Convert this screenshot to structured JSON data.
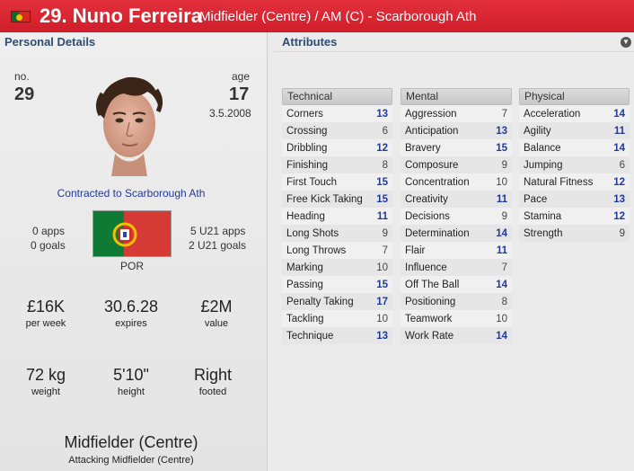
{
  "header": {
    "name": "29. Nuno Ferreira",
    "role": "Midfielder (Centre) / AM (C) - Scarborough Ath"
  },
  "personal": {
    "title": "Personal Details",
    "no_label": "no.",
    "no_value": "29",
    "age_label": "age",
    "age_value": "17",
    "dob": "3.5.2008",
    "contract": "Contracted to Scarborough Ath",
    "apps": "0 apps",
    "goals": "0 goals",
    "u21_apps": "5 U21 apps",
    "u21_goals": "2 U21 goals",
    "nation": "POR",
    "wage_value": "£16K",
    "wage_label": "per week",
    "expires_value": "30.6.28",
    "expires_label": "expires",
    "value_value": "£2M",
    "value_label": "value",
    "weight_value": "72 kg",
    "weight_label": "weight",
    "height_value": "5'10\"",
    "height_label": "height",
    "foot_value": "Right",
    "foot_label": "footed",
    "position_main": "Midfielder (Centre)",
    "position_sub": "Attacking Midfielder (Centre)"
  },
  "attributes": {
    "title": "Attributes",
    "technical": {
      "label": "Technical",
      "rows": [
        {
          "name": "Corners",
          "value": "13"
        },
        {
          "name": "Crossing",
          "value": "6"
        },
        {
          "name": "Dribbling",
          "value": "12"
        },
        {
          "name": "Finishing",
          "value": "8"
        },
        {
          "name": "First Touch",
          "value": "15"
        },
        {
          "name": "Free Kick Taking",
          "value": "15"
        },
        {
          "name": "Heading",
          "value": "11"
        },
        {
          "name": "Long Shots",
          "value": "9"
        },
        {
          "name": "Long Throws",
          "value": "7"
        },
        {
          "name": "Marking",
          "value": "10"
        },
        {
          "name": "Passing",
          "value": "15"
        },
        {
          "name": "Penalty Taking",
          "value": "17"
        },
        {
          "name": "Tackling",
          "value": "10"
        },
        {
          "name": "Technique",
          "value": "13"
        }
      ]
    },
    "mental": {
      "label": "Mental",
      "rows": [
        {
          "name": "Aggression",
          "value": "7"
        },
        {
          "name": "Anticipation",
          "value": "13"
        },
        {
          "name": "Bravery",
          "value": "15"
        },
        {
          "name": "Composure",
          "value": "9"
        },
        {
          "name": "Concentration",
          "value": "10"
        },
        {
          "name": "Creativity",
          "value": "11"
        },
        {
          "name": "Decisions",
          "value": "9"
        },
        {
          "name": "Determination",
          "value": "14"
        },
        {
          "name": "Flair",
          "value": "11"
        },
        {
          "name": "Influence",
          "value": "7"
        },
        {
          "name": "Off The Ball",
          "value": "14"
        },
        {
          "name": "Positioning",
          "value": "8"
        },
        {
          "name": "Teamwork",
          "value": "10"
        },
        {
          "name": "Work Rate",
          "value": "14"
        }
      ]
    },
    "physical": {
      "label": "Physical",
      "rows": [
        {
          "name": "Acceleration",
          "value": "14"
        },
        {
          "name": "Agility",
          "value": "11"
        },
        {
          "name": "Balance",
          "value": "14"
        },
        {
          "name": "Jumping",
          "value": "6"
        },
        {
          "name": "Natural Fitness",
          "value": "12"
        },
        {
          "name": "Pace",
          "value": "13"
        },
        {
          "name": "Stamina",
          "value": "12"
        },
        {
          "name": "Strength",
          "value": "9"
        }
      ]
    }
  },
  "colors": {
    "header_red": "#d7232f",
    "high_value": "#1f3a9a",
    "title_blue": "#2e4d6f"
  }
}
